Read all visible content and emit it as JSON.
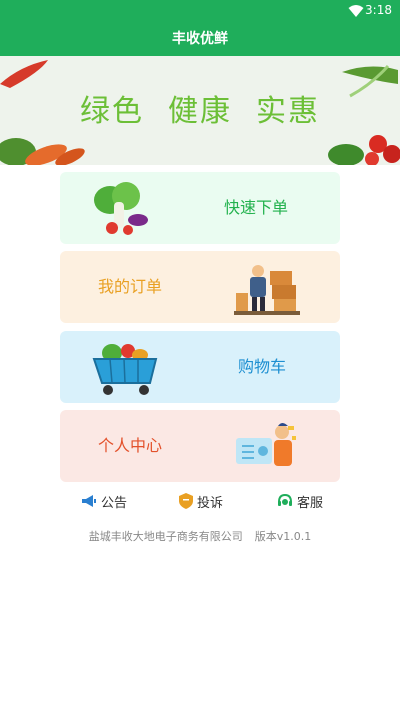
{
  "status_bar": {
    "time": "3:18",
    "wifi_icon": "wifi-icon"
  },
  "app_bar": {
    "title": "丰收优鲜"
  },
  "banner": {
    "slogan": [
      "绿色",
      "健康",
      "实惠"
    ]
  },
  "menu": [
    {
      "id": "quick-order",
      "label": "快速下单",
      "icon": "vegetables-icon",
      "bg": "#eafcf1",
      "color": "#23b24e"
    },
    {
      "id": "my-orders",
      "label": "我的订单",
      "icon": "warehouse-worker-icon",
      "bg": "#fdf0e0",
      "color": "#e9a023"
    },
    {
      "id": "cart",
      "label": "购物车",
      "icon": "shopping-cart-icon",
      "bg": "#d9f1fb",
      "color": "#1d8fd1"
    },
    {
      "id": "profile",
      "label": "个人中心",
      "icon": "profile-card-icon",
      "bg": "#fbe8e4",
      "color": "#e3512b"
    }
  ],
  "links": {
    "notice": {
      "label": "公告",
      "icon": "megaphone-icon"
    },
    "complaint": {
      "label": "投诉",
      "icon": "shield-icon"
    },
    "service": {
      "label": "客服",
      "icon": "headset-icon"
    }
  },
  "footer": {
    "company": "盐城丰收大地电子商务有限公司",
    "version": "版本v1.0.1"
  },
  "colors": {
    "primary": "#1fae5b"
  }
}
